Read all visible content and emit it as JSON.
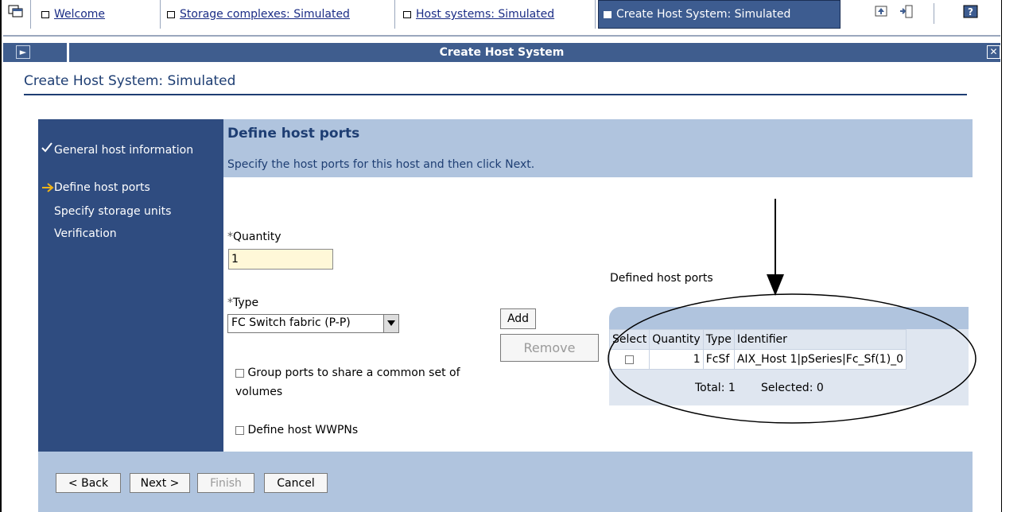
{
  "tabs": [
    {
      "label": "Welcome"
    },
    {
      "label": "Storage complexes: Simulated"
    },
    {
      "label": "Host systems: Simulated"
    },
    {
      "label": "Create Host System: Simulated"
    }
  ],
  "titlebar": {
    "title": "Create Host System"
  },
  "page": {
    "title": "Create Host System: Simulated"
  },
  "nav": {
    "steps": [
      {
        "label": "General host information",
        "state": "completed"
      },
      {
        "label": "Define host ports",
        "state": "current"
      },
      {
        "label": "Specify storage units",
        "state": "pending"
      },
      {
        "label": "Verification",
        "state": "pending"
      }
    ]
  },
  "content": {
    "heading": "Define host ports",
    "instructions": "Specify the host ports for this host and then click Next."
  },
  "form": {
    "quantity_label": "Quantity",
    "quantity_value": "1",
    "type_label": "Type",
    "type_value": "FC Switch fabric (P-P)",
    "group_ports_label": "Group ports to share a common set of volumes",
    "define_wwpns_label": "Define host WWPNs",
    "required_marker": "*"
  },
  "buttons": {
    "add": "Add",
    "remove": "Remove",
    "back": "< Back",
    "next": "Next >",
    "finish": "Finish",
    "cancel": "Cancel"
  },
  "ports_table": {
    "caption": "Defined host ports",
    "columns": [
      "Select",
      "Quantity",
      "Type",
      "Identifier"
    ],
    "rows": [
      {
        "quantity": "1",
        "type": "FcSf",
        "identifier": "AIX_Host 1|pSeries|Fc_Sf(1)_0"
      }
    ],
    "total": "Total: 1",
    "selected": "Selected: 0"
  },
  "colors": {
    "nav_bg": "#2f4c80",
    "wizard_bg": "#b0c4de",
    "titlebar_bg": "#3f5d8e",
    "title_text": "#1e3e73",
    "quantity_input_bg": "#fff8d8"
  }
}
